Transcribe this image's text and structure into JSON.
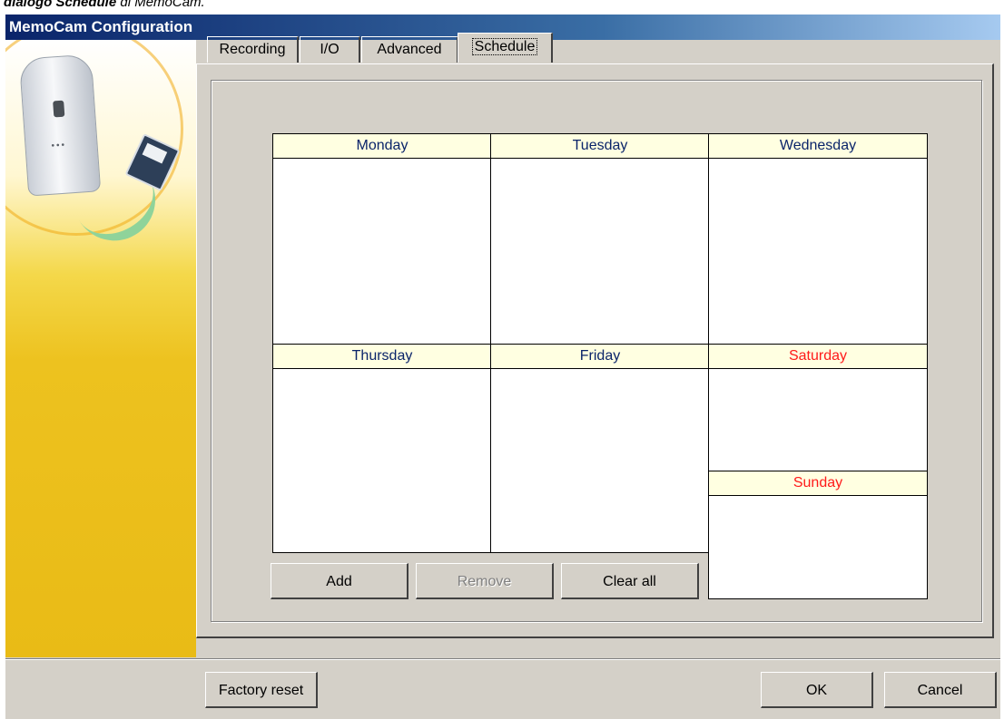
{
  "caption": {
    "prefix": "dialogo",
    "bold": "Schedule",
    "suffix": "di MemoCam."
  },
  "window": {
    "title": "MemoCam Configuration"
  },
  "tabs": [
    {
      "label": "Recording"
    },
    {
      "label": "I/O"
    },
    {
      "label": "Advanced"
    },
    {
      "label": "Schedule",
      "active": true
    }
  ],
  "schedule": {
    "monday": "Monday",
    "tuesday": "Tuesday",
    "wednesday": "Wednesday",
    "thursday": "Thursday",
    "friday": "Friday",
    "saturday": "Saturday",
    "sunday": "Sunday"
  },
  "buttons": {
    "add": "Add",
    "remove": "Remove",
    "clear_all": "Clear all",
    "factory_reset": "Factory reset",
    "ok": "OK",
    "cancel": "Cancel"
  },
  "colors": {
    "weekday_header_text": "#0a246a",
    "weekend_header_text": "#ff1a1a",
    "header_bg": "#ffffe1",
    "sidebar_yellow": "#e9bb16"
  }
}
